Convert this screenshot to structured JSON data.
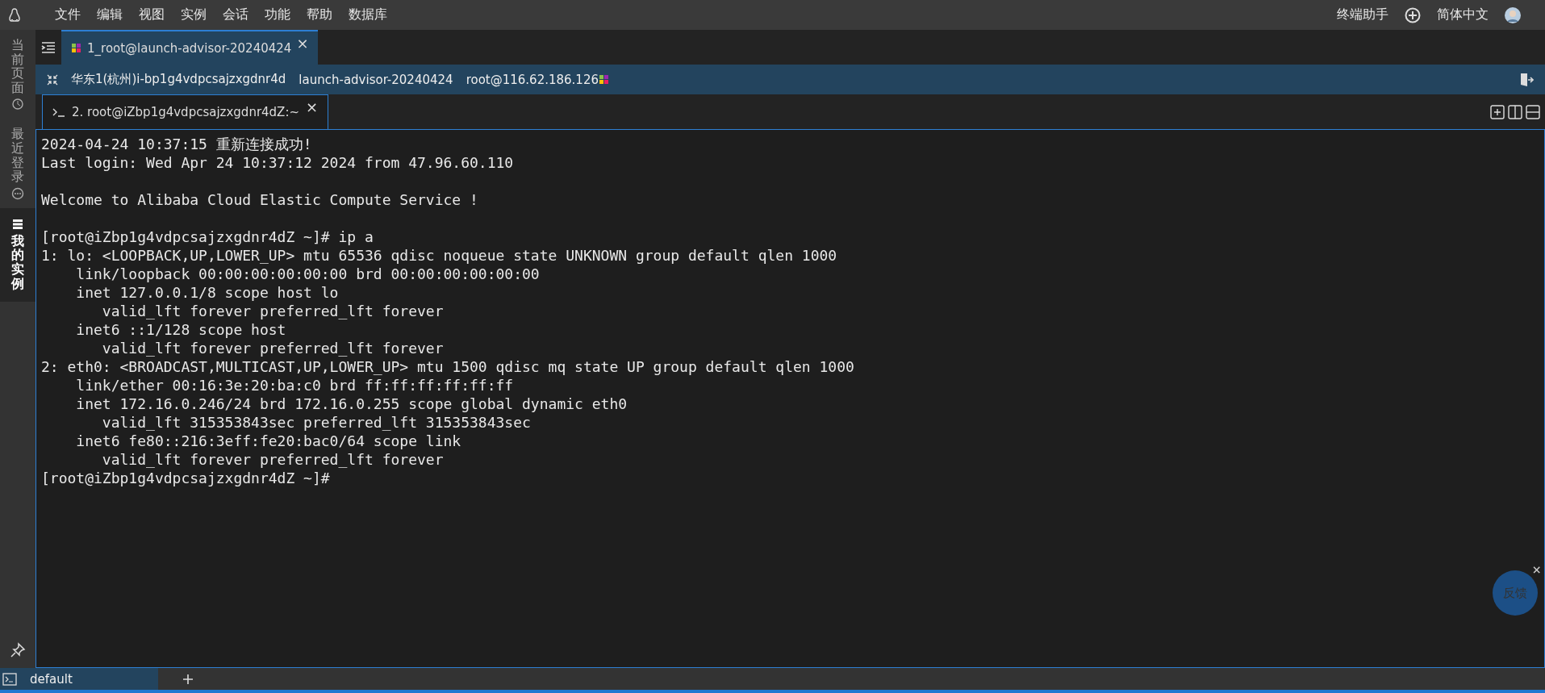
{
  "menu": [
    "文件",
    "编辑",
    "视图",
    "实例",
    "会话",
    "功能",
    "帮助",
    "数据库"
  ],
  "menu_right": {
    "assistant": "终端助手",
    "language": "简体中文"
  },
  "sidebar": {
    "items": [
      {
        "label": "当前页面",
        "selected": false
      },
      {
        "label": "最近登录",
        "selected": false
      },
      {
        "label": "我的实例",
        "selected": true
      }
    ]
  },
  "session_tabs": [
    {
      "label": "1_root@launch-advisor-20240424",
      "close": "×",
      "selected": true
    }
  ],
  "info_bar": [
    "华东1(杭州)i-bp1g4vdpcsajzxgdnr4d",
    "launch-advisor-20240424",
    "root@116.62.186.126"
  ],
  "terminal_tabs": [
    {
      "label": "2. root@iZbp1g4vdpcsajzxgdnr4dZ:~",
      "close": "×",
      "selected": true
    }
  ],
  "terminal_blocks": [
    [
      "2024-04-24 10:37:15 重新连接成功!",
      "Last login: Wed Apr 24 10:37:12 2024 from 47.96.60.110"
    ],
    [
      "Welcome to Alibaba Cloud Elastic Compute Service !"
    ],
    [
      "[root@iZbp1g4vdpcsajzxgdnr4dZ ~]# ip a",
      "1: lo: <LOOPBACK,UP,LOWER_UP> mtu 65536 qdisc noqueue state UNKNOWN group default qlen 1000",
      "    link/loopback 00:00:00:00:00:00 brd 00:00:00:00:00:00",
      "    inet 127.0.0.1/8 scope host lo",
      "       valid_lft forever preferred_lft forever",
      "    inet6 ::1/128 scope host",
      "       valid_lft forever preferred_lft forever",
      "2: eth0: <BROADCAST,MULTICAST,UP,LOWER_UP> mtu 1500 qdisc mq state UP group default qlen 1000",
      "    link/ether 00:16:3e:20:ba:c0 brd ff:ff:ff:ff:ff:ff",
      "    inet 172.16.0.246/24 brd 172.16.0.255 scope global dynamic eth0",
      "       valid_lft 315353843sec preferred_lft 315353843sec",
      "    inet6 fe80::216:3eff:fe20:bac0/64 scope link",
      "       valid_lft forever preferred_lft forever",
      "[root@iZbp1g4vdpcsajzxgdnr4dZ ~]#"
    ]
  ],
  "feedback": {
    "label": "反馈",
    "close": "×"
  },
  "bottom_tabs": [
    {
      "label": "default",
      "selected": true
    }
  ]
}
